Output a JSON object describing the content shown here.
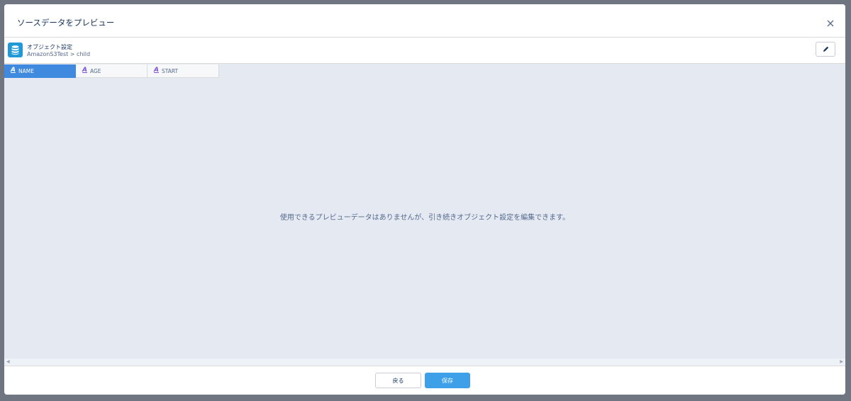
{
  "modal": {
    "title": "ソースデータをプレビュー"
  },
  "object_bar": {
    "icon": "database-icon",
    "title": "オブジェクト設定",
    "subtitle": "AmazonS3Test > child"
  },
  "columns": [
    {
      "type_icon": "A",
      "label": "NAME",
      "active": true
    },
    {
      "type_icon": "A",
      "label": "AGE",
      "active": false
    },
    {
      "type_icon": "A",
      "label": "START",
      "active": false
    }
  ],
  "empty_message": "使用できるプレビューデータはありませんが、引き続きオブジェクト設定を編集できます。",
  "footer": {
    "back_label": "戻る",
    "save_label": "保存"
  },
  "colors": {
    "accent": "#3f89de",
    "save_button": "#3fa0ea",
    "preview_background": "#e5eaf2",
    "object_icon": "#1f9ad6",
    "type_icon": "#7b4fd6"
  }
}
